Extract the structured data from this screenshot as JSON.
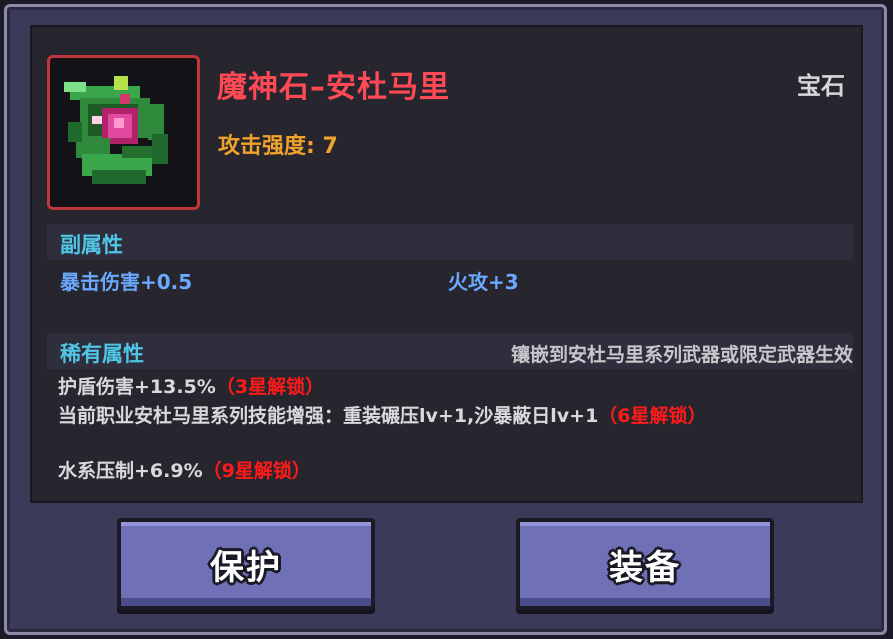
{
  "item": {
    "name": "魔神石–安杜马里",
    "type": "宝石",
    "attack": "攻击强度: 7",
    "icon": "demon-stone-icon",
    "rarity_color": "#c0363b"
  },
  "sub_attributes": {
    "title": "副属性",
    "stats": [
      "暴击伤害+0.5",
      "火攻+3"
    ]
  },
  "rare_attributes": {
    "title": "稀有属性",
    "note": "镶嵌到安杜马里系列武器或限定武器生效",
    "lines": [
      {
        "text": "护盾伤害+13.5%",
        "unlock": "（3星解锁）"
      },
      {
        "text": "当前职业安杜马里系列技能增强：重装碾压lv+1,沙暴蔽日lv+1",
        "unlock": "（6星解锁）"
      },
      {
        "text": "水系压制+6.9%",
        "unlock": "（9星解锁）"
      }
    ]
  },
  "buttons": {
    "protect": "保护",
    "equip": "装备"
  },
  "colors": {
    "title": "#ff4a55",
    "attack": "#f0a32c",
    "section": "#4fc6e6",
    "stat": "#6ba9ff",
    "unlock": "#ff1a1a",
    "button": "#6f70b5"
  }
}
